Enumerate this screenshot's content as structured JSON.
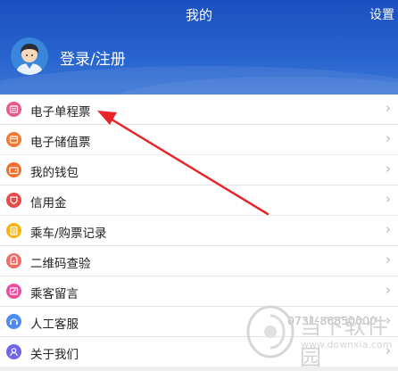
{
  "header": {
    "title": "我的",
    "settings_label": "设置",
    "login_label": "登录/注册"
  },
  "groups": [
    {
      "items": [
        {
          "label": "电子单程票",
          "icon": "ticket-icon",
          "color": "#e85a89"
        },
        {
          "label": "电子储值票",
          "icon": "stored-value-card-icon",
          "color": "#f27933"
        }
      ]
    },
    {
      "items": [
        {
          "label": "我的钱包",
          "icon": "wallet-icon",
          "color": "#f06f2c"
        },
        {
          "label": "信用金",
          "icon": "credit-icon",
          "color": "#e84a4a"
        }
      ]
    },
    {
      "items": [
        {
          "label": "乘车/购票记录",
          "icon": "record-icon",
          "color": "#f3b414"
        },
        {
          "label": "二维码查验",
          "icon": "qr-code-icon",
          "color": "#f06b64"
        },
        {
          "label": "乘客留言",
          "icon": "message-icon",
          "color": "#e94fa0"
        },
        {
          "label": "人工客服",
          "icon": "customer-service-icon",
          "color": "#4c8bf0",
          "extra": "0731-86850000"
        },
        {
          "label": "关于我们",
          "icon": "about-icon",
          "color": "#6f66e8"
        }
      ]
    }
  ],
  "watermark": {
    "text": "当下软件园",
    "url": "www.downxia.com"
  },
  "colors": {
    "header_blue": "#1f57c4",
    "arrow_red": "#e8262a"
  }
}
